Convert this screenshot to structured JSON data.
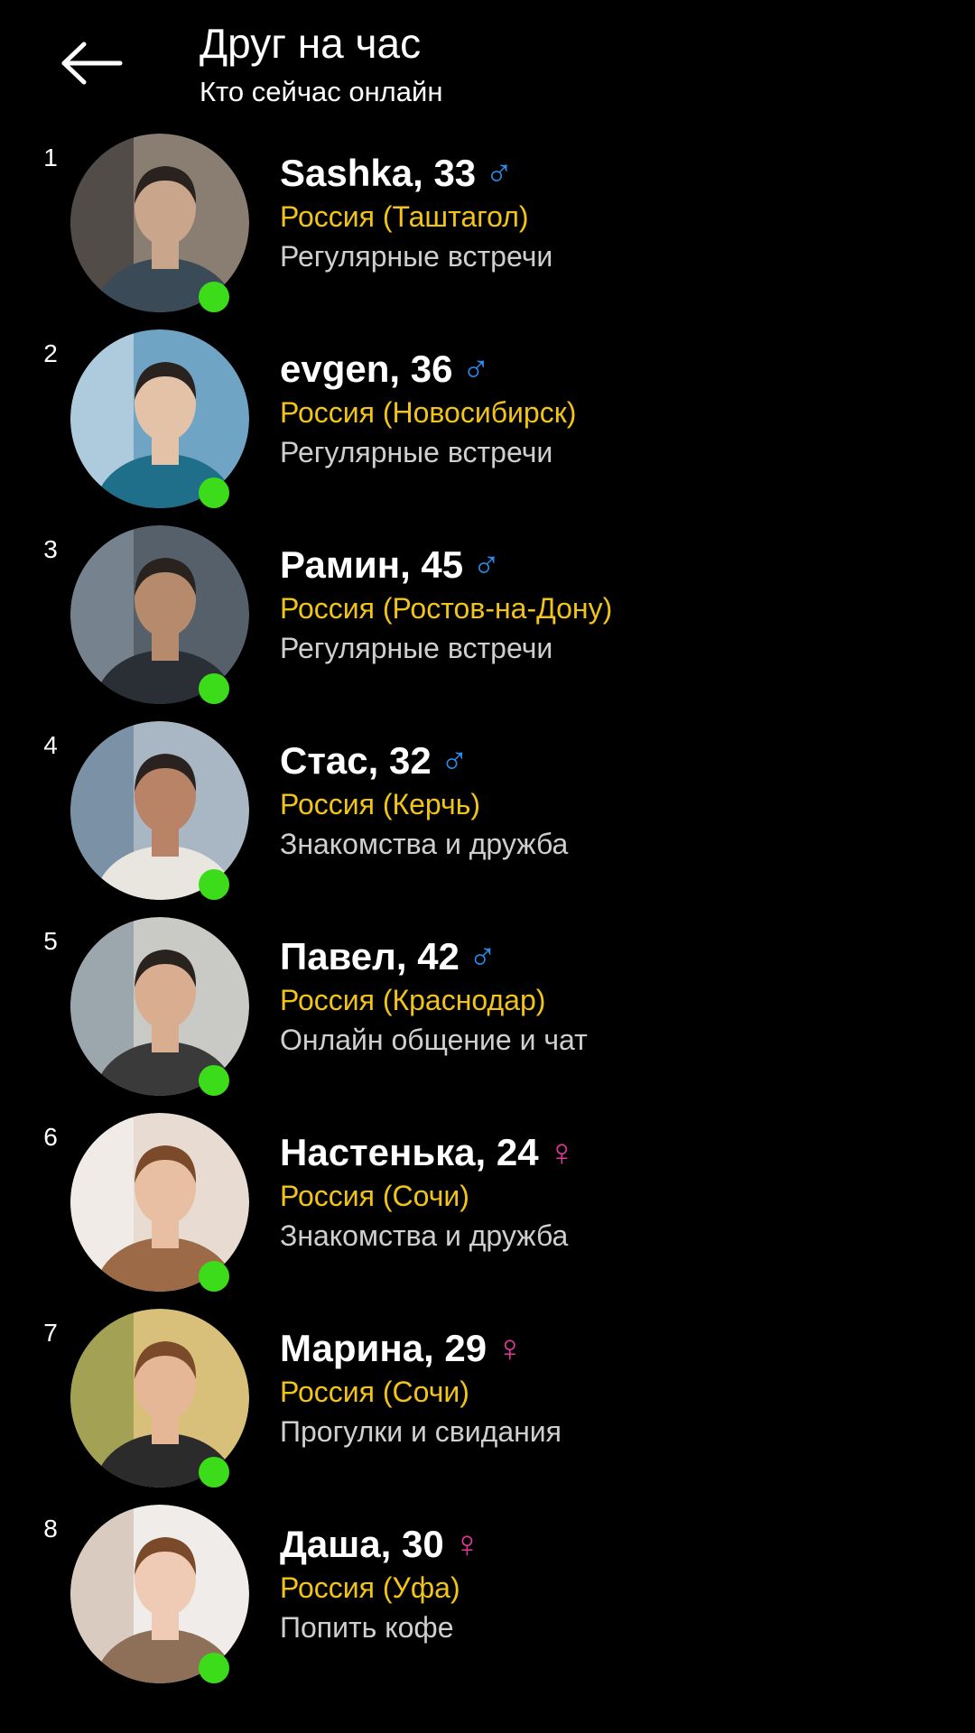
{
  "header": {
    "title": "Друг на час",
    "subtitle": "Кто сейчас онлайн",
    "back_icon": "arrow-left-icon"
  },
  "colors": {
    "background": "#000000",
    "text": "#ffffff",
    "location": "#f2c418",
    "purpose": "#cfcfcf",
    "online": "#3ddc1a",
    "male": "#2a8ff0",
    "female": "#e0399a"
  },
  "users": [
    {
      "rank": "1",
      "name_age": "Sashka, 33",
      "gender": "male",
      "gender_symbol": "♂",
      "location": "Россия (Таштагол)",
      "purpose": "Регулярные встречи",
      "online": true
    },
    {
      "rank": "2",
      "name_age": "evgen, 36",
      "gender": "male",
      "gender_symbol": "♂",
      "location": "Россия (Новосибирск)",
      "purpose": "Регулярные встречи",
      "online": true
    },
    {
      "rank": "3",
      "name_age": "Рамин, 45",
      "gender": "male",
      "gender_symbol": "♂",
      "location": "Россия (Ростов-на-Дону)",
      "purpose": "Регулярные встречи",
      "online": true
    },
    {
      "rank": "4",
      "name_age": "Стас, 32",
      "gender": "male",
      "gender_symbol": "♂",
      "location": "Россия (Керчь)",
      "purpose": "Знакомства и дружба",
      "online": true
    },
    {
      "rank": "5",
      "name_age": "Павел, 42",
      "gender": "male",
      "gender_symbol": "♂",
      "location": "Россия (Краснодар)",
      "purpose": "Онлайн общение и чат",
      "online": true
    },
    {
      "rank": "6",
      "name_age": "Настенька, 24",
      "gender": "female",
      "gender_symbol": "♀",
      "location": "Россия (Сочи)",
      "purpose": "Знакомства и дружба",
      "online": true
    },
    {
      "rank": "7",
      "name_age": "Марина, 29",
      "gender": "female",
      "gender_symbol": "♀",
      "location": "Россия (Сочи)",
      "purpose": "Прогулки и свидания",
      "online": true
    },
    {
      "rank": "8",
      "name_age": "Даша, 30",
      "gender": "female",
      "gender_symbol": "♀",
      "location": "Россия (Уфа)",
      "purpose": "Попить кофе",
      "online": true
    }
  ]
}
